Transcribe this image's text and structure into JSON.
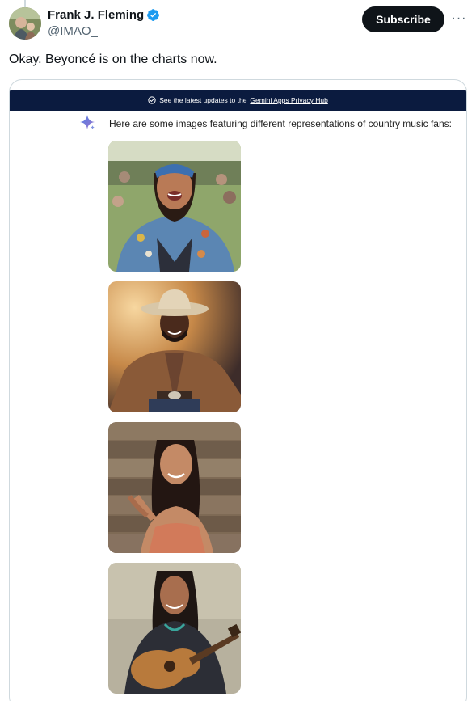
{
  "author": {
    "name": "Frank J. Fleming",
    "handle": "@IMAO_",
    "verified": true
  },
  "actions": {
    "subscribe_label": "Subscribe",
    "more_label": "···"
  },
  "tweet": {
    "text": "Okay. Beyoncé is on the charts now."
  },
  "card": {
    "banner_prefix": "See the latest updates to the",
    "banner_link": "Gemini Apps Privacy Hub",
    "intro": "Here are some images featuring different representations of country music fans:",
    "images": [
      "woman-bandana-denim-jacket-photo",
      "man-cowboy-hat-dancing-photo",
      "woman-clapping-wood-wall-photo",
      "man-playing-acoustic-guitar-photo"
    ]
  },
  "colors": {
    "banner_bg": "#0b1b3f",
    "subscribe_bg": "#0f1419",
    "verified_blue": "#1d9bf0",
    "secondary_text": "#536471"
  }
}
